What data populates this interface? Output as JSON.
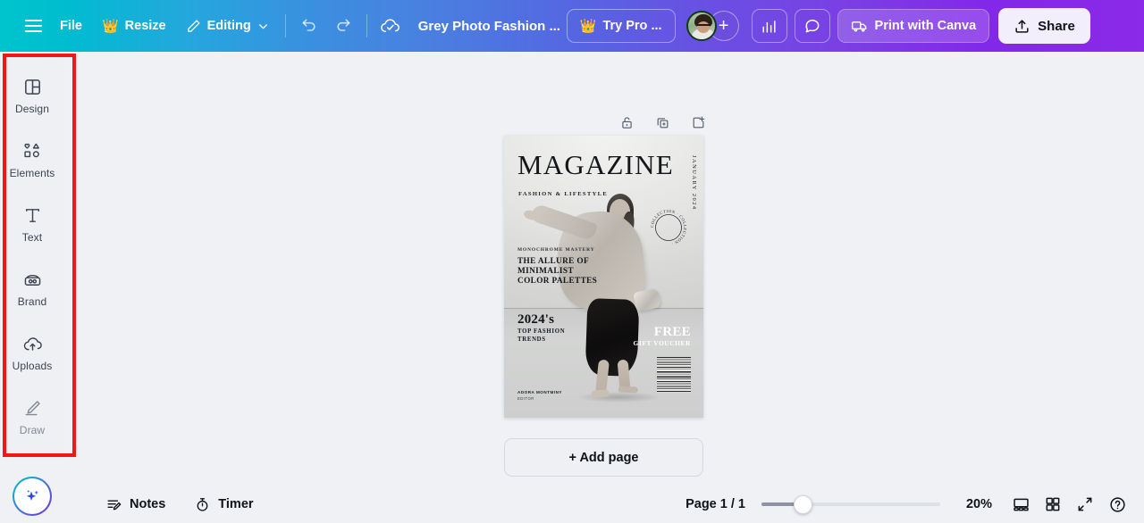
{
  "topbar": {
    "menu_icon": "hamburger-menu-icon",
    "file_label": "File",
    "resize_label": "Resize",
    "resize_badge_icon": "crown-icon",
    "editing_label": "Editing",
    "editing_chevron_icon": "chevron-down-icon",
    "undo_icon": "undo-icon",
    "redo_icon": "redo-icon",
    "cloud_saved_icon": "cloud-check-icon",
    "document_title": "Grey Photo Fashion ...",
    "try_pro_label": "Try Pro ...",
    "try_pro_icon": "crown-icon",
    "avatar_icon": "user-avatar",
    "add_collaborator_icon": "plus-icon",
    "insights_icon": "bar-chart-icon",
    "comments_icon": "comment-bubble-icon",
    "print_label": "Print with Canva",
    "print_icon": "delivery-truck-icon",
    "share_label": "Share",
    "share_icon": "share-upload-icon"
  },
  "sidebar": {
    "highlight_color": "#f31616",
    "items": [
      {
        "label": "Design",
        "icon": "design-layout-icon",
        "dim": false
      },
      {
        "label": "Elements",
        "icon": "shapes-elements-icon",
        "dim": false
      },
      {
        "label": "Text",
        "icon": "text-t-icon",
        "dim": false
      },
      {
        "label": "Brand",
        "icon": "brand-kit-icon",
        "dim": false
      },
      {
        "label": "Uploads",
        "icon": "cloud-upload-icon",
        "dim": false
      },
      {
        "label": "Draw",
        "icon": "pen-draw-icon",
        "dim": true
      }
    ]
  },
  "page_toolbar": {
    "lock_icon": "unlock-padlock-icon",
    "duplicate_icon": "duplicate-page-icon",
    "add_page_icon": "add-page-icon"
  },
  "design": {
    "title": "MAGAZINE",
    "subtitle": "FASHION & LIFESTYLE",
    "date": "JANUARY 2024",
    "kicker": "MONOCHROME MASTERY",
    "headline": "THE ALLURE OF\nMINIMALIST\nCOLOR PALETTES",
    "year": "2024's",
    "trends": "TOP FASHION\nTRENDS",
    "free_big": "FREE",
    "free_small": "GIFT VOUCHER",
    "badge_text": "COLLECTION · COLLECTION · ",
    "editor_name": "ADORA MONTMINY",
    "editor_role": "EDITOR",
    "barcode_icon": "barcode-icon"
  },
  "canvas": {
    "add_page_label": "+ Add page"
  },
  "bottombar": {
    "notes_label": "Notes",
    "notes_icon": "notes-lines-pencil-icon",
    "timer_label": "Timer",
    "timer_icon": "stopwatch-icon",
    "page_indicator": "Page 1 / 1",
    "zoom_level": "20%",
    "zoom_slider_value": 22,
    "presenter_view_icon": "presenter-view-icon",
    "grid_view_icon": "grid-view-icon",
    "fullscreen_icon": "fullscreen-expand-icon",
    "help_icon": "help-question-icon",
    "ai_assistant_icon": "sparkle-magic-icon"
  }
}
